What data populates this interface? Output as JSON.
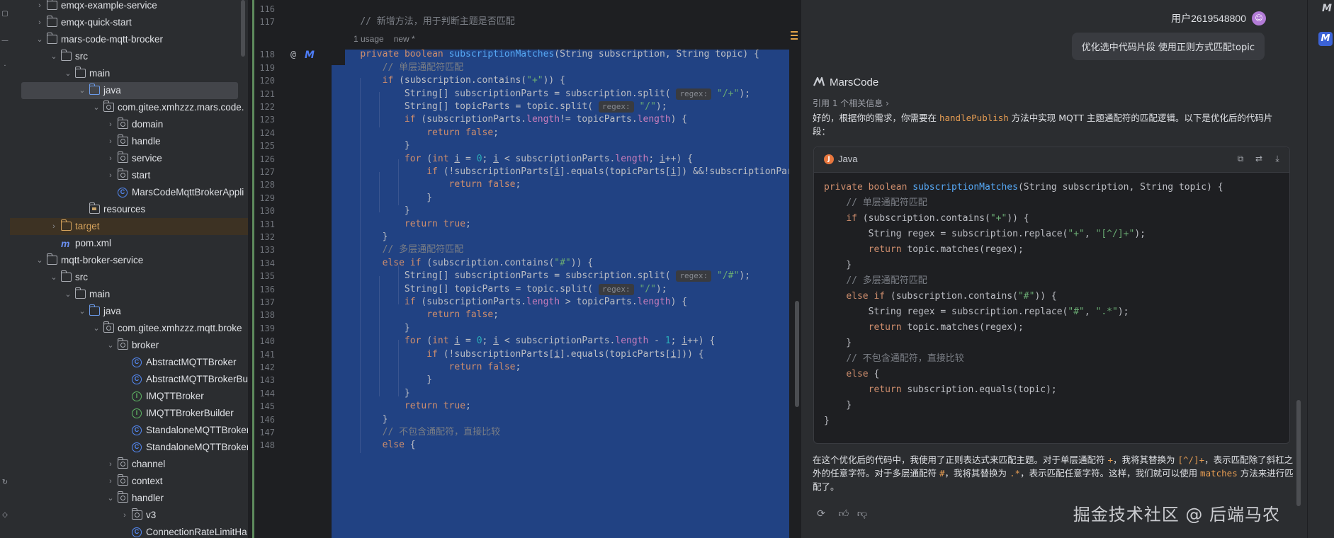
{
  "project_tree": [
    {
      "depth": 1,
      "state": "collapsed",
      "icon": "module-folder-icon",
      "label": "emqx-example-service"
    },
    {
      "depth": 1,
      "state": "collapsed",
      "icon": "module-folder-icon",
      "label": "emqx-quick-start"
    },
    {
      "depth": 1,
      "state": "expanded",
      "icon": "module-folder-icon",
      "label": "mars-code-mqtt-brocker"
    },
    {
      "depth": 2,
      "state": "expanded",
      "icon": "folder-icon",
      "label": "src"
    },
    {
      "depth": 3,
      "state": "expanded",
      "icon": "folder-icon",
      "label": "main"
    },
    {
      "depth": 4,
      "state": "expanded",
      "icon": "source-folder-icon",
      "label": "java",
      "selected": true
    },
    {
      "depth": 5,
      "state": "expanded",
      "icon": "package-icon",
      "label": "com.gitee.xmhzzz.mars.code."
    },
    {
      "depth": 6,
      "state": "collapsed",
      "icon": "package-icon",
      "label": "domain"
    },
    {
      "depth": 6,
      "state": "collapsed",
      "icon": "package-icon",
      "label": "handle"
    },
    {
      "depth": 6,
      "state": "collapsed",
      "icon": "package-icon",
      "label": "service"
    },
    {
      "depth": 6,
      "state": "collapsed",
      "icon": "package-icon",
      "label": "start"
    },
    {
      "depth": 6,
      "state": "leaf",
      "icon": "class-icon",
      "label": "MarsCodeMqttBrokerAppli"
    },
    {
      "depth": 4,
      "state": "leaf",
      "icon": "resources-folder-icon",
      "label": "resources"
    },
    {
      "depth": 2,
      "state": "collapsed",
      "icon": "excluded-folder-icon",
      "label": "target",
      "excluded": true
    },
    {
      "depth": 2,
      "state": "leaf",
      "icon": "maven-icon",
      "label": "pom.xml"
    },
    {
      "depth": 1,
      "state": "expanded",
      "icon": "module-folder-icon",
      "label": "mqtt-broker-service"
    },
    {
      "depth": 2,
      "state": "expanded",
      "icon": "folder-icon",
      "label": "src"
    },
    {
      "depth": 3,
      "state": "expanded",
      "icon": "folder-icon",
      "label": "main"
    },
    {
      "depth": 4,
      "state": "expanded",
      "icon": "source-folder-icon",
      "label": "java"
    },
    {
      "depth": 5,
      "state": "expanded",
      "icon": "package-icon",
      "label": "com.gitee.xmhzzz.mqtt.broke"
    },
    {
      "depth": 6,
      "state": "expanded",
      "icon": "package-icon",
      "label": "broker"
    },
    {
      "depth": 7,
      "state": "leaf",
      "icon": "abstract-class-icon",
      "label": "AbstractMQTTBroker"
    },
    {
      "depth": 7,
      "state": "leaf",
      "icon": "abstract-class-icon",
      "label": "AbstractMQTTBrokerBui"
    },
    {
      "depth": 7,
      "state": "leaf",
      "icon": "interface-icon",
      "label": "IMQTTBroker"
    },
    {
      "depth": 7,
      "state": "leaf",
      "icon": "interface-icon",
      "label": "IMQTTBrokerBuilder"
    },
    {
      "depth": 7,
      "state": "leaf",
      "icon": "class-icon",
      "label": "StandaloneMQTTBroker"
    },
    {
      "depth": 7,
      "state": "leaf",
      "icon": "class-icon",
      "label": "StandaloneMQTTBroker"
    },
    {
      "depth": 6,
      "state": "collapsed",
      "icon": "package-icon",
      "label": "channel"
    },
    {
      "depth": 6,
      "state": "collapsed",
      "icon": "package-icon",
      "label": "context"
    },
    {
      "depth": 6,
      "state": "expanded",
      "icon": "package-icon",
      "label": "handler"
    },
    {
      "depth": 7,
      "state": "collapsed",
      "icon": "package-icon",
      "label": "v3"
    },
    {
      "depth": 7,
      "state": "leaf",
      "icon": "class-icon",
      "label": "ConnectionRateLimitHa"
    }
  ],
  "editor": {
    "usage_hint": "1 usage",
    "new_hint": "new *",
    "hint_regex": "regex:",
    "line_numbers": [
      "116",
      "117",
      "",
      "118",
      "119",
      "120",
      "121",
      "122",
      "123",
      "124",
      "125",
      "126",
      "127",
      "128",
      "129",
      "130",
      "131",
      "132",
      "133",
      "134",
      "135",
      "136",
      "137",
      "138",
      "139",
      "140",
      "141",
      "142",
      "143",
      "144",
      "145",
      "146",
      "147",
      "148"
    ],
    "lines": [
      "",
      "    // 新增方法，用于判断主题是否匹配",
      "",
      "    private boolean subscriptionMatches(String subscription, String topic) {",
      "        // 单层通配符匹配",
      "        if (subscription.contains(\"+\")) {",
      "            String[] subscriptionParts = subscription.split( regex: \"/+\");",
      "            String[] topicParts = topic.split( regex: \"/\");",
      "            if (subscriptionParts.length!= topicParts.length) {",
      "                return false;",
      "            }",
      "            for (int i = 0; i < subscriptionParts.length; i++) {",
      "                if (!subscriptionParts[i].equals(topicParts[i]) &&!subscriptionPart",
      "                    return false;",
      "                }",
      "            }",
      "            return true;",
      "        }",
      "        // 多层通配符匹配",
      "        else if (subscription.contains(\"#\")) {",
      "            String[] subscriptionParts = subscription.split( regex: \"/#\");",
      "            String[] topicParts = topic.split( regex: \"/\");",
      "            if (subscriptionParts.length > topicParts.length) {",
      "                return false;",
      "            }",
      "            for (int i = 0; i < subscriptionParts.length - 1; i++) {",
      "                if (!subscriptionParts[i].equals(topicParts[i])) {",
      "                    return false;",
      "                }",
      "            }",
      "            return true;",
      "        }",
      "        // 不包含通配符，直接比较",
      "        else {"
    ]
  },
  "assistant": {
    "user_name": "用户2619548800",
    "user_message": "优化选中代码片段 使用正则方式匹配topic",
    "bot_name": "MarsCode",
    "reference": "引用 1 个相关信息 ›",
    "intro_before": "好的，根据你的需求，你需要在 ",
    "intro_ident": "handlePublish",
    "intro_after": " 方法中实现 MQTT 主题通配符的匹配逻辑。以下是优化后的代码片段：",
    "code_language": "Java",
    "code_lines": [
      "private boolean subscriptionMatches(String subscription, String topic) {",
      "    // 单层通配符匹配",
      "    if (subscription.contains(\"+\")) {",
      "        String regex = subscription.replace(\"+\", \"[^/]+\");",
      "        return topic.matches(regex);",
      "    }",
      "    // 多层通配符匹配",
      "    else if (subscription.contains(\"#\")) {",
      "        String regex = subscription.replace(\"#\", \".*\");",
      "        return topic.matches(regex);",
      "    }",
      "    // 不包含通配符，直接比较",
      "    else {",
      "        return subscription.equals(topic);",
      "    }",
      "}"
    ],
    "explain_1": "在这个优化后的代码中，我使用了正则表达式来匹配主题。对于单层通配符 ",
    "explain_plus": "+",
    "explain_2": "，我将其替换为 ",
    "explain_regex1": "[^/]+",
    "explain_3": "，表示匹配除了斜杠之外的任意字符。对于多层通配符 ",
    "explain_hash": "#",
    "explain_4": "，我将其替换为 ",
    "explain_regex2": ".*",
    "explain_5": "，表示匹配任意字符。这样，我们就可以使用 ",
    "explain_matches": "matches",
    "explain_6": " 方法来进行匹配了。",
    "watermark": "掘金技术社区 @ 后端马农"
  }
}
